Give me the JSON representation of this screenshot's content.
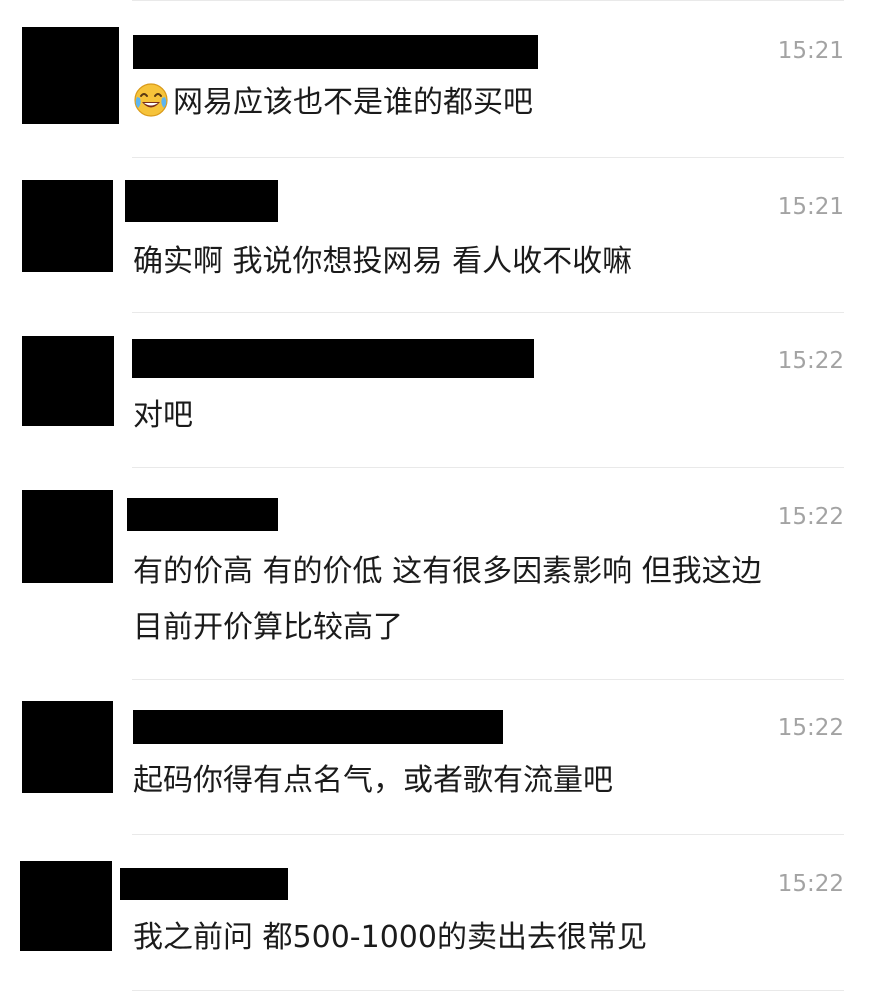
{
  "messages": [
    {
      "time": "15:21",
      "text": "网易应该也不是谁的都买吧",
      "emoji": "face-with-tears-of-joy-icon"
    },
    {
      "time": "15:21",
      "text": "确实啊 我说你想投网易 看人收不收嘛"
    },
    {
      "time": "15:22",
      "text": "对吧"
    },
    {
      "time": "15:22",
      "lines": [
        "有的价高 有的价低 这有很多因素影响 但我这边",
        "目前开价算比较高了"
      ]
    },
    {
      "time": "15:22",
      "text": "起码你得有点名气，或者歌有流量吧"
    },
    {
      "time": "15:22",
      "text": "我之前问 都500-1000的卖出去很常见"
    }
  ],
  "colors": {
    "background": "#ffffff",
    "text": "#1b1b1b",
    "time": "#a3a3a3",
    "divider": "#e9e9e9",
    "redaction": "#000000"
  }
}
